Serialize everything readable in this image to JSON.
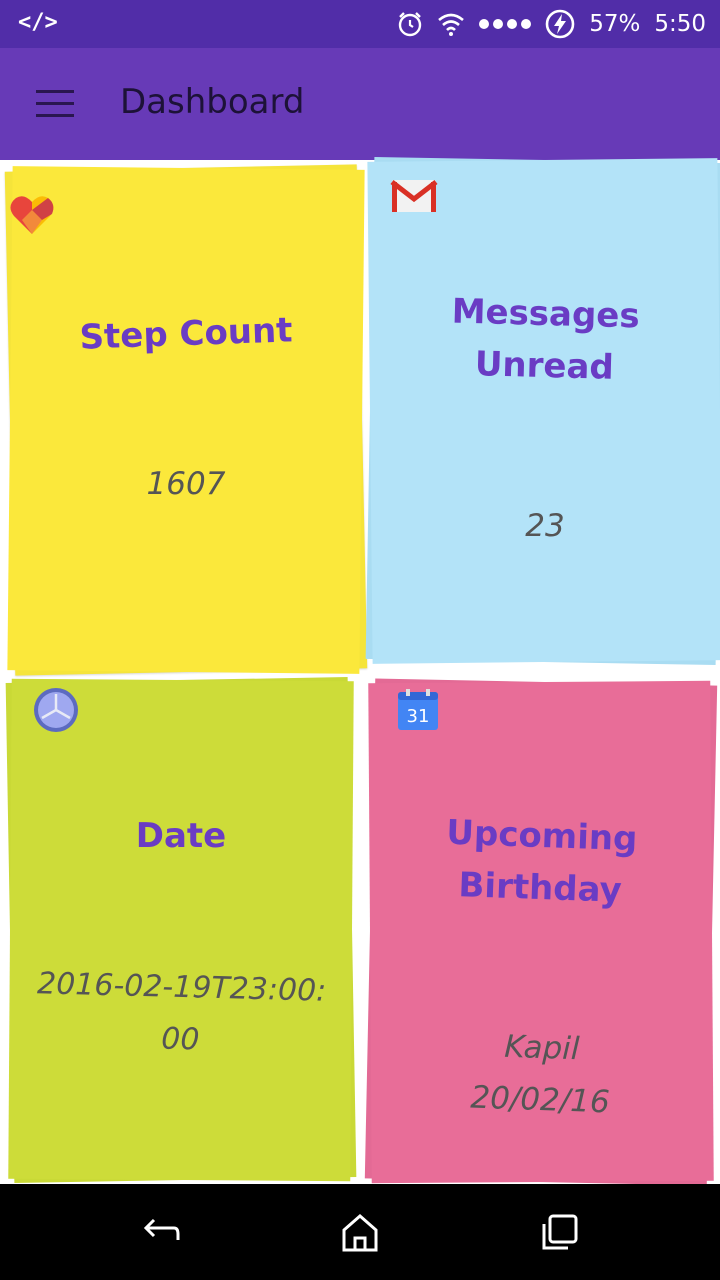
{
  "status_bar": {
    "developer_icon": "</>",
    "icons": [
      "alarm-icon",
      "wifi-icon",
      "signal-icon",
      "battery-charging-icon"
    ],
    "battery": "57%",
    "time": "5:50"
  },
  "app_bar": {
    "menu_icon": "hamburger-menu-icon",
    "title": "Dashboard"
  },
  "cards": {
    "steps": {
      "icon": "google-fit-heart-icon",
      "title": "Step Count",
      "value": "1607",
      "color": "#fbe83b"
    },
    "messages": {
      "icon": "gmail-icon",
      "title_line1": "Messages",
      "title_line2": "Unread",
      "value": "23",
      "color": "#b3e3f8"
    },
    "date": {
      "icon": "clock-icon",
      "title": "Date",
      "value": "2016-02-19T23:00:00",
      "color": "#cddc39"
    },
    "birthday": {
      "icon": "calendar-icon",
      "icon_text": "31",
      "title_line1": "Upcoming",
      "title_line2": "Birthday",
      "value_line1": "Kapil",
      "value_line2": "20/02/16",
      "color": "#e86d98"
    }
  },
  "nav_bar": {
    "icons": [
      "back-icon",
      "home-icon",
      "recents-icon"
    ]
  },
  "colors": {
    "status_bar": "#512da8",
    "app_bar": "#673ab7",
    "title_text": "#6a3cc4"
  }
}
